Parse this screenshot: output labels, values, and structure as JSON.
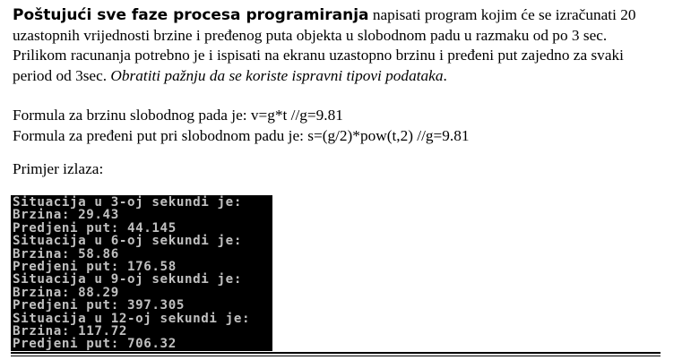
{
  "task": {
    "lead_bold": "Poštujući sve faze procesa programiranja",
    "line1_rest": " napisati program kojim će se izračunati 20",
    "line2": "uzastopnih vrijednosti brzine i pređenog puta objekta u slobodnom padu u razmaku od po 3 sec.",
    "line3": "Prilikom racunanja potrebno je i ispisati na ekranu uzastopno brzinu i pređeni put zajedno za svaki",
    "line4_start": "period od 3sec. ",
    "line4_italic": "Obratiti pažnju da se koriste ispravni tipovi podataka",
    "line4_end": "."
  },
  "formulas": {
    "speed": "Formula za brzinu slobodnog pada je: v=g*t  //g=9.81",
    "distance": "Formula za pređeni put pri slobodnom padu je: s=(g/2)*pow(t,2)  //g=9.81"
  },
  "example_label": "Primjer izlaza:",
  "console": {
    "lines": [
      "Situacija u 3-oj sekundi je:",
      "Brzina: 29.43",
      "Predjeni put: 44.145",
      "Situacija u 6-oj sekundi je:",
      "Brzina: 58.86",
      "Predjeni put: 176.58",
      "Situacija u 9-oj sekundi je:",
      "Brzina: 88.29",
      "Predjeni put: 397.305",
      "Situacija u 12-oj sekundi je:",
      "Brzina: 117.72",
      "Predjeni put: 706.32"
    ],
    "background": "#000000",
    "text_color": "#c0c0c0"
  }
}
